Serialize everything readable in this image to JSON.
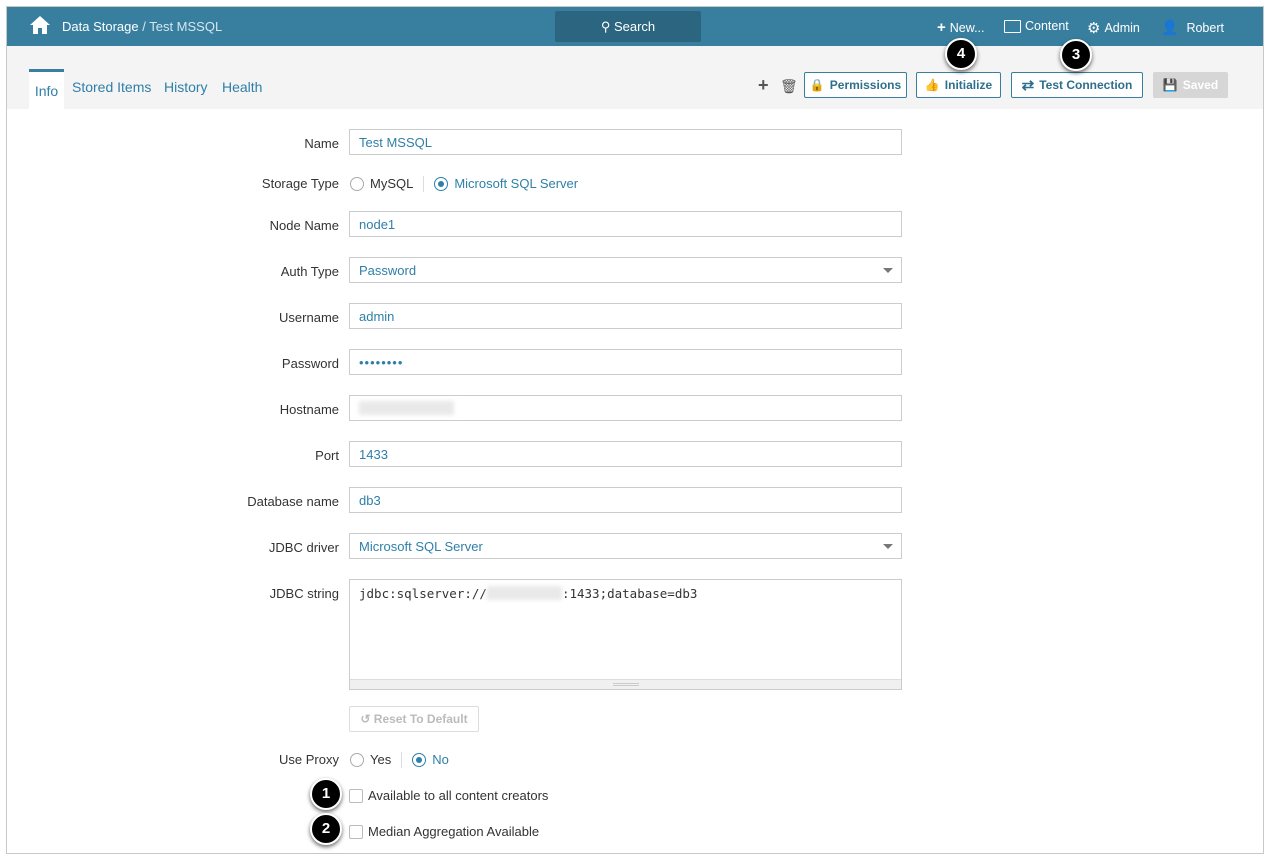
{
  "header": {
    "breadcrumb_root": "Data Storage",
    "breadcrumb_sep": " / ",
    "breadcrumb_current": "Test MSSQL",
    "search_label": "Search",
    "new_label": "New...",
    "content_label": "Content",
    "admin_label": "Admin",
    "user_label": "Robert"
  },
  "tabs": [
    "Info",
    "Stored Items",
    "History",
    "Health"
  ],
  "toolbar": {
    "permissions": "Permissions",
    "initialize": "Initialize",
    "test_connection": "Test Connection",
    "saved": "Saved"
  },
  "form": {
    "name_label": "Name",
    "name_value": "Test MSSQL",
    "storage_type_label": "Storage Type",
    "storage_options": [
      "MySQL",
      "Microsoft SQL Server"
    ],
    "storage_selected": "Microsoft SQL Server",
    "node_label": "Node Name",
    "node_value": "node1",
    "auth_label": "Auth Type",
    "auth_value": "Password",
    "username_label": "Username",
    "username_value": "admin",
    "password_label": "Password",
    "password_value": "••••••••",
    "hostname_label": "Hostname",
    "port_label": "Port",
    "port_value": "1433",
    "db_label": "Database name",
    "db_value": "db3",
    "driver_label": "JDBC driver",
    "driver_value": "Microsoft SQL Server",
    "jdbc_label": "JDBC string",
    "jdbc_prefix": "jdbc:sqlserver://",
    "jdbc_suffix": ":1433;database=db3",
    "reset_label": "Reset To Default",
    "proxy_label": "Use Proxy",
    "proxy_options": [
      "Yes",
      "No"
    ],
    "proxy_selected": "No",
    "available_label": "Available to all content creators",
    "median_label": "Median Aggregation Available"
  },
  "badges": [
    "1",
    "2",
    "3",
    "4"
  ]
}
